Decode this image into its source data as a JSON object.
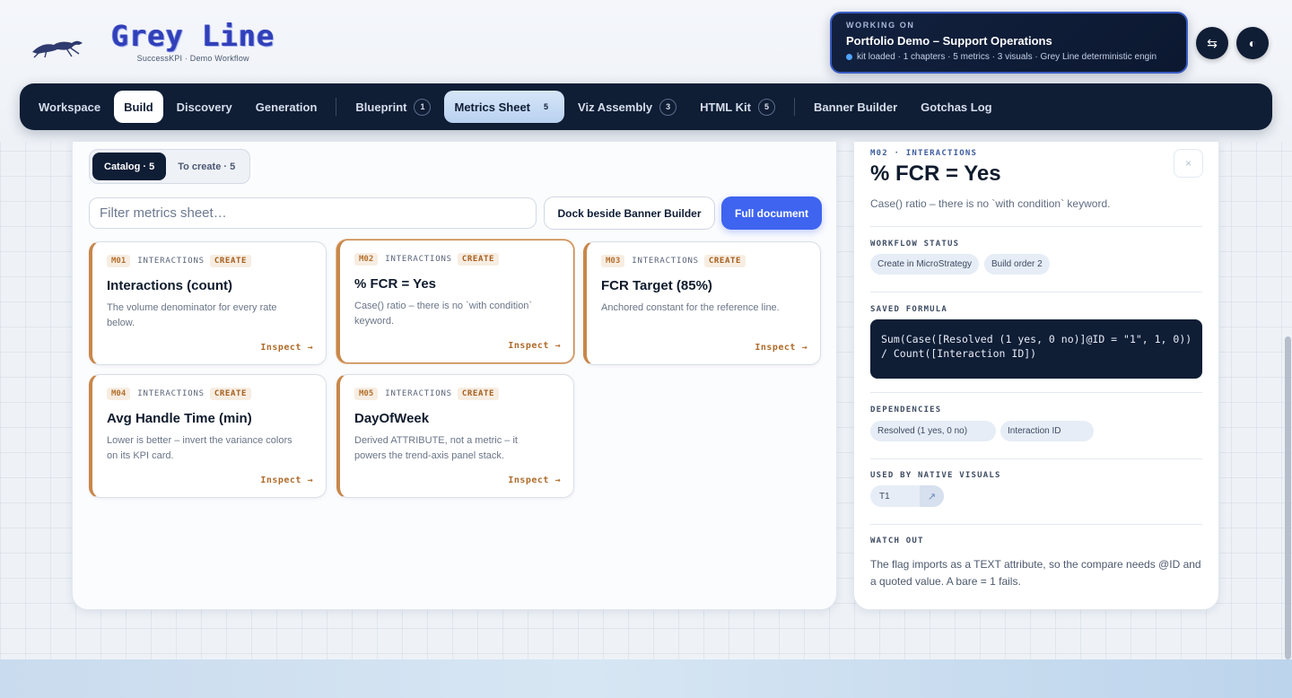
{
  "brand": {
    "name": "Grey Line",
    "subtitle": "SuccessKPI · Demo Workflow"
  },
  "working": {
    "label": "WORKING ON",
    "title": "Portfolio Demo – Support Operations",
    "status": "kit loaded · 1 chapters · 5 metrics · 3 visuals · Grey Line deterministic engin"
  },
  "header_buttons": {
    "swap_icon": "⇆",
    "theme_icon": "◐"
  },
  "nav": {
    "items": [
      {
        "label": "Workspace",
        "badge": ""
      },
      {
        "label": "Build",
        "badge": ""
      },
      {
        "label": "Discovery",
        "badge": ""
      },
      {
        "label": "Generation",
        "badge": ""
      },
      {
        "label": "Blueprint",
        "badge": "1"
      },
      {
        "label": "Metrics Sheet",
        "badge": "5"
      },
      {
        "label": "Viz Assembly",
        "badge": "3"
      },
      {
        "label": "HTML Kit",
        "badge": "5"
      },
      {
        "label": "Banner Builder",
        "badge": ""
      },
      {
        "label": "Gotchas Log",
        "badge": ""
      }
    ]
  },
  "tabs": {
    "catalog": "Catalog · 5",
    "to_create": "To create · 5"
  },
  "filter": {
    "placeholder": "Filter metrics sheet…",
    "value": ""
  },
  "buttons": {
    "dock": "Dock beside Banner Builder",
    "full": "Full document"
  },
  "cards": [
    {
      "id": "M01",
      "category": "INTERACTIONS",
      "status": "CREATE",
      "title": "Interactions (count)",
      "desc": "The volume denominator for every rate below.",
      "inspect": "Inspect →"
    },
    {
      "id": "M02",
      "category": "INTERACTIONS",
      "status": "CREATE",
      "title": "% FCR = Yes",
      "desc": "Case() ratio – there is no `with condition` keyword.",
      "inspect": "Inspect →"
    },
    {
      "id": "M03",
      "category": "INTERACTIONS",
      "status": "CREATE",
      "title": "FCR Target (85%)",
      "desc": "Anchored constant for the reference line.",
      "inspect": "Inspect →"
    },
    {
      "id": "M04",
      "category": "INTERACTIONS",
      "status": "CREATE",
      "title": "Avg Handle Time (min)",
      "desc": "Lower is better – invert the variance colors on its KPI card.",
      "inspect": "Inspect →"
    },
    {
      "id": "M05",
      "category": "INTERACTIONS",
      "status": "CREATE",
      "title": "DayOfWeek",
      "desc": "Derived ATTRIBUTE, not a metric – it powers the trend-axis panel stack.",
      "inspect": "Inspect →"
    }
  ],
  "detail": {
    "kicker": "M02 · INTERACTIONS",
    "title": "% FCR = Yes",
    "close_icon": "×",
    "desc": "Case() ratio – there is no `with condition` keyword.",
    "workflow_label": "WORKFLOW STATUS",
    "workflow_pills": [
      "Create in MicroStrategy",
      "Build order 2"
    ],
    "formula_label": "SAVED FORMULA",
    "formula": "Sum(Case([Resolved (1 yes, 0 no)]@ID = \"1\", 1, 0))\n/ Count([Interaction ID])",
    "dependencies_label": "DEPENDENCIES",
    "dependencies": [
      "Resolved (1 yes, 0 no)",
      "Interaction ID"
    ],
    "used_by_label": "USED BY NATIVE VISUALS",
    "used_by": "T1",
    "used_by_icon": "↗",
    "watch_label": "WATCH OUT",
    "watch_text": "The flag imports as a TEXT attribute, so the compare needs @ID and a quoted value. A bare = 1 fails."
  },
  "colors": {
    "navy": "#0f1d35",
    "accent_blue": "#3e64f0",
    "card_accent": "#c8874a"
  }
}
